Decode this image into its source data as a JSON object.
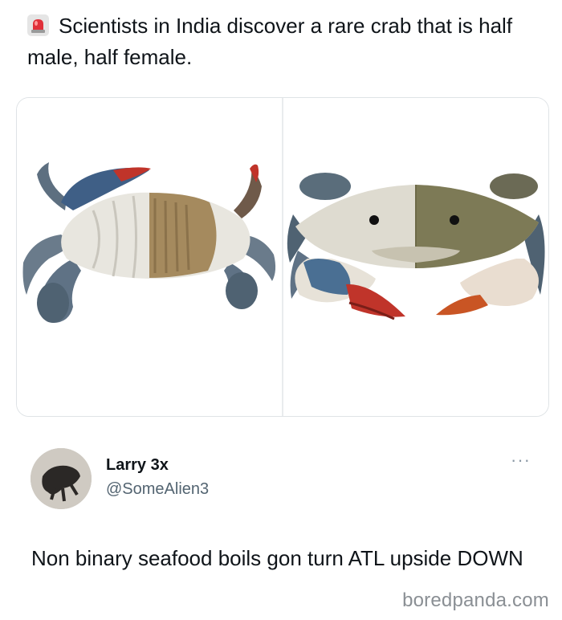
{
  "post": {
    "icon": "siren-icon",
    "headline": "Scientists in India discover a rare crab that is half male, half female."
  },
  "media": {
    "left_image": "crab-underside-photo",
    "right_image": "crab-top-photo"
  },
  "reply": {
    "name": "Larry 3x",
    "handle": "@SomeAlien3",
    "more_label": "···",
    "text": "Non binary seafood boils gon turn ATL upside DOWN"
  },
  "watermark": "boredpanda.com",
  "colors": {
    "text": "#0f1419",
    "secondary": "#536471",
    "siren": "#e0303a",
    "crab_blue": "#4a6f93",
    "crab_red": "#c0342a"
  }
}
